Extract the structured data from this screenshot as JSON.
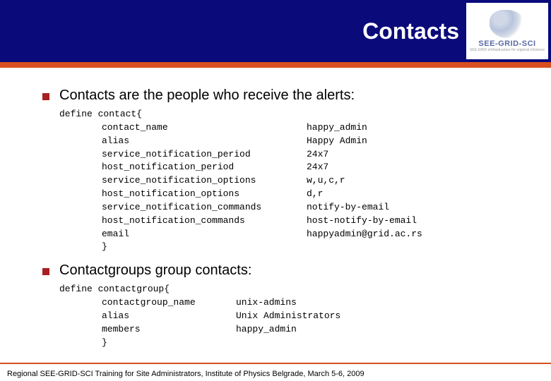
{
  "header": {
    "title": "Contacts",
    "logo_main": "SEE-GRID-SCI",
    "logo_sub": "SEE-GRID eInfrastructure for regional eScience"
  },
  "sections": [
    {
      "heading": "Contacts are the people who receive the alerts:",
      "code": {
        "open": "define contact{",
        "fields": [
          {
            "key": "contact_name",
            "value": "happy_admin"
          },
          {
            "key": "alias",
            "value": "Happy Admin"
          },
          {
            "key": "service_notification_period",
            "value": "24x7"
          },
          {
            "key": "host_notification_period",
            "value": "24x7"
          },
          {
            "key": "service_notification_options",
            "value": "w,u,c,r"
          },
          {
            "key": "host_notification_options",
            "value": "d,r"
          },
          {
            "key": "service_notification_commands",
            "value": "notify-by-email"
          },
          {
            "key": "host_notification_commands",
            "value": "host-notify-by-email"
          },
          {
            "key": "email",
            "value": "happyadmin@grid.ac.rs"
          }
        ],
        "close": "}"
      }
    },
    {
      "heading": "Contactgroups group contacts:",
      "code": {
        "open": "define contactgroup{",
        "fields": [
          {
            "key": "contactgroup_name",
            "value": "unix-admins"
          },
          {
            "key": "alias",
            "value": "Unix Administrators"
          },
          {
            "key": "members",
            "value": "happy_admin"
          }
        ],
        "close": "}"
      }
    }
  ],
  "footer": "Regional SEE-GRID-SCI Training for Site Administrators, Institute of Physics Belgrade, March 5-6, 2009"
}
